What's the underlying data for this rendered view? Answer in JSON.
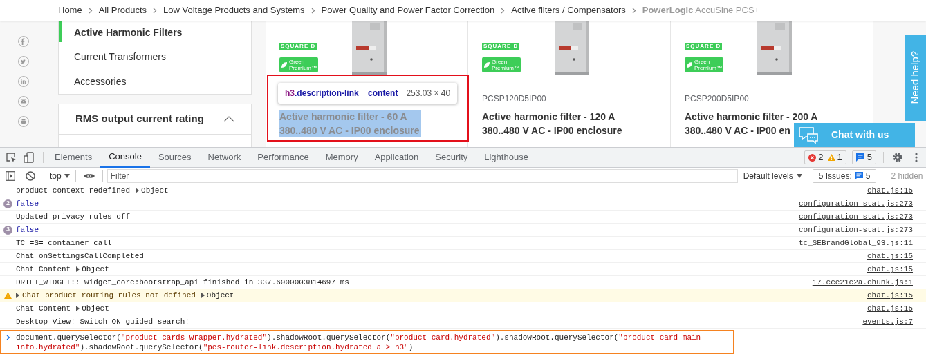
{
  "breadcrumb": [
    {
      "label": "Home",
      "current": false
    },
    {
      "label": "All Products",
      "current": false
    },
    {
      "label": "Low Voltage Products and Systems",
      "current": false
    },
    {
      "label": "Power Quality and Power Factor Correction",
      "current": false
    },
    {
      "label": "Active filters / Compensators",
      "current": false
    },
    {
      "label": "**PowerLogic** AccuSine PCS+",
      "current": true
    }
  ],
  "sidebar": {
    "items": [
      {
        "label": "Active Harmonic Filters",
        "selected": true
      },
      {
        "label": "Current Transformers",
        "selected": false
      },
      {
        "label": "Accessories",
        "selected": false
      }
    ]
  },
  "filter": {
    "title": "RMS output current rating",
    "expanded": true
  },
  "products": [
    {
      "brand": "SQUARE D",
      "badge": "Green Premium™",
      "title_lines": [
        "Active harmonic filter - 60 A",
        "380..480 V AC - IP00 enclosure"
      ],
      "highlighted": true
    },
    {
      "brand": "SQUARE D",
      "badge": "Green Premium™",
      "reference": "PCSP120D5IP00",
      "title_lines": [
        "Active harmonic filter - 120 A",
        "380..480 V AC - IP00 enclosure"
      ],
      "highlighted": false
    },
    {
      "brand": "SQUARE D",
      "badge": "Green Premium™",
      "reference": "PCSP200D5IP00",
      "title_lines": [
        "Active harmonic filter - 200 A",
        "380..480 V AC - IP00 en"
      ],
      "highlighted": false
    }
  ],
  "inspector_tooltip": {
    "tag": "h3",
    "class": ".description-link__content",
    "size": "253.03 × 40"
  },
  "help_tab": "Need help?",
  "chat_button": "Chat with us",
  "devtools": {
    "tabs": [
      {
        "label": "Elements",
        "selected": false
      },
      {
        "label": "Console",
        "selected": true
      },
      {
        "label": "Sources",
        "selected": false
      },
      {
        "label": "Network",
        "selected": false
      },
      {
        "label": "Performance",
        "selected": false
      },
      {
        "label": "Memory",
        "selected": false
      },
      {
        "label": "Application",
        "selected": false
      },
      {
        "label": "Security",
        "selected": false
      },
      {
        "label": "Lighthouse",
        "selected": false
      }
    ],
    "errors": "2",
    "warnings": "1",
    "messages": "5",
    "context": "top",
    "filter_placeholder": "Filter",
    "levels": "Default levels",
    "issues_label": "5 Issues:",
    "issues_count": "5",
    "hidden": "2 hidden",
    "console": [
      {
        "kind": "log",
        "text": "product context redefined",
        "object": "Object",
        "source": "chat.js:15"
      },
      {
        "kind": "value",
        "count": "2",
        "text": "false",
        "source": "configuration-stat.js:273"
      },
      {
        "kind": "log",
        "text": "Updated privacy rules off",
        "source": "configuration-stat.js:273"
      },
      {
        "kind": "value",
        "count": "3",
        "text": "false",
        "source": "configuration-stat.js:273"
      },
      {
        "kind": "log",
        "text": "TC =S= container call",
        "source": "tc_SEBrandGlobal_93.js:11"
      },
      {
        "kind": "log",
        "text": "Chat onSettingsCallCompleted",
        "source": "chat.js:15"
      },
      {
        "kind": "log",
        "text": "Chat Content",
        "object": "Object",
        "source": "chat.js:15"
      },
      {
        "kind": "log",
        "text": "DRIFT_WIDGET:: widget_core:bootstrap_api finished in 337.6000003814697 ms",
        "source": "17.cce21c2a.chunk.js:1"
      },
      {
        "kind": "warning",
        "text": "Chat product routing rules not defined",
        "object": "Object",
        "source": "chat.js:15"
      },
      {
        "kind": "log",
        "text": "Chat Content",
        "object": "Object",
        "source": "chat.js:15"
      },
      {
        "kind": "log",
        "text": "Desktop View! Switch ON guided search!",
        "source": "events.js:7"
      }
    ],
    "input": [
      {
        "kind": "plain",
        "text": "document.querySelector("
      },
      {
        "kind": "string",
        "text": "\"product-cards-wrapper.hydrated\""
      },
      {
        "kind": "plain",
        "text": ").shadowRoot.querySelector("
      },
      {
        "kind": "string",
        "text": "\"product-card.hydrated\""
      },
      {
        "kind": "plain",
        "text": ").shadowRoot.querySelector("
      },
      {
        "kind": "string",
        "text": "\"product-card-main-info.hydrated\""
      },
      {
        "kind": "plain",
        "text": ").shadowRoot.querySelector("
      },
      {
        "kind": "string",
        "text": "\"pes-router-link.description.hydrated a > h3\""
      },
      {
        "kind": "plain",
        "text": ")"
      }
    ]
  }
}
